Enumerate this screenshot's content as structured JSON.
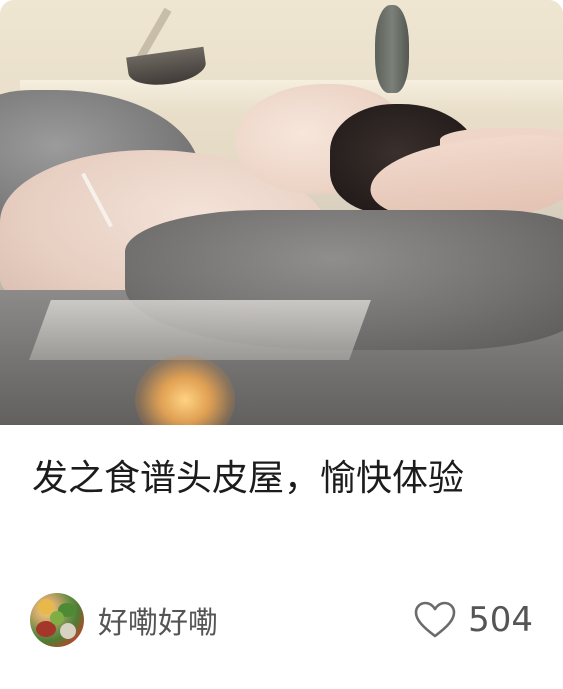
{
  "post": {
    "title": "发之食谱头皮屋，愉快体验",
    "author_name": "好嘞好嘞",
    "like_count": "504",
    "cover_image": "spa-head-massage-photo",
    "author_avatar": "vegetables-avatar-photo",
    "like_icon": "heart-outline-icon"
  },
  "colors": {
    "title_text": "#1c1c1c",
    "meta_text": "#555555",
    "background": "#ffffff"
  }
}
